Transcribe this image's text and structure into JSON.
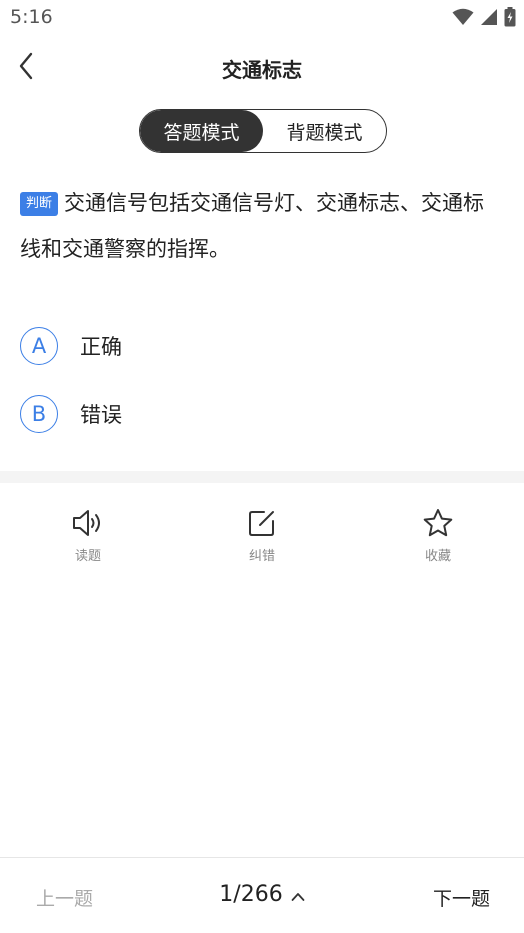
{
  "status_bar": {
    "time": "5:16",
    "icons": [
      "wifi-icon",
      "cellular-signal-icon",
      "battery-charging-icon"
    ]
  },
  "header": {
    "title": "交通标志",
    "back_icon": "chevron-left-icon"
  },
  "mode_toggle": {
    "options": [
      "答题模式",
      "背题模式"
    ],
    "selected": "答题模式"
  },
  "question": {
    "type_badge": "判断",
    "text": "交通信号包括交通信号灯、交通标志、交通标线和交通警察的指挥。"
  },
  "options": [
    {
      "letter": "A",
      "text": "正确"
    },
    {
      "letter": "B",
      "text": "错误"
    }
  ],
  "actions": [
    {
      "label": "读题",
      "icon": "speaker-icon"
    },
    {
      "label": "纠错",
      "icon": "edit-icon"
    },
    {
      "label": "收藏",
      "icon": "star-icon"
    }
  ],
  "navigation": {
    "prev_label": "上一题",
    "page_indicator": "1/266",
    "next_label": "下一题",
    "expand_icon": "chevron-up-icon"
  },
  "colors": {
    "accent": "#3c7fe6",
    "toggle_active": "#333333",
    "muted_text": "#888888",
    "disabled_text": "#aaaaaa"
  }
}
